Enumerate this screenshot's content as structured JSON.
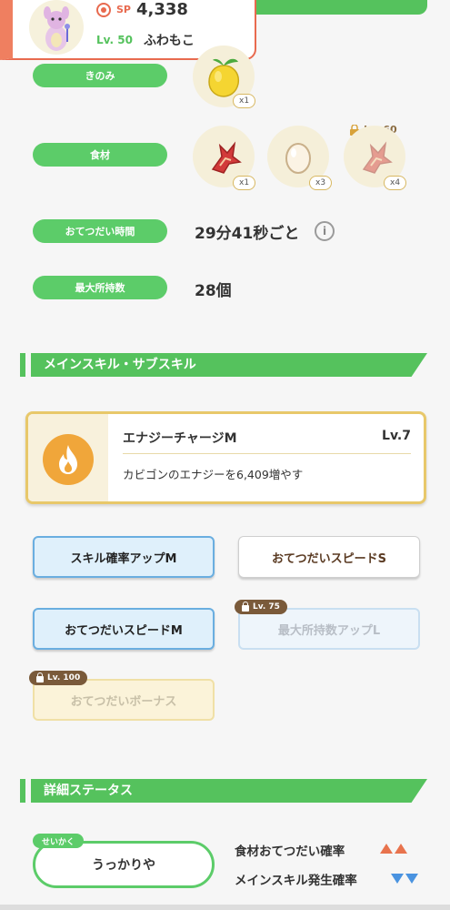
{
  "header": {
    "sp_label": "SP",
    "sp_value": "4,338",
    "level_label": "Lv. 50",
    "nickname": "ふわもこ"
  },
  "info": {
    "berry_label": "きのみ",
    "berry_qty": "x1",
    "ingredients_label": "食材",
    "ingredients": [
      {
        "icon": "tomato-icon",
        "qty": "x1"
      },
      {
        "icon": "egg-icon",
        "qty": "x3"
      },
      {
        "icon": "tomato-icon",
        "qty": "x4",
        "locked_level": "Lv. 60"
      }
    ],
    "help_time_label": "おてつだい時間",
    "help_time_value": "29分41秒ごと",
    "carry_label": "最大所持数",
    "carry_value": "28個"
  },
  "skills": {
    "section_title": "メインスキル・サブスキル",
    "main_skill": {
      "name": "エナジーチャージM",
      "level": "Lv.7",
      "description": "カビゴンのエナジーを6,409増やす"
    },
    "sub_skills": [
      {
        "label": "スキル確率アップM",
        "style": "blue"
      },
      {
        "label": "おてつだいスピードS",
        "style": "white"
      },
      {
        "label": "おてつだいスピードM",
        "style": "blue"
      },
      {
        "label": "最大所持数アップL",
        "style": "blue-locked",
        "lock_level": "Lv. 75"
      },
      {
        "label": "おてつだいボーナス",
        "style": "gold-locked",
        "lock_level": "Lv. 100"
      }
    ]
  },
  "details": {
    "section_title": "詳細ステータス",
    "nature_tag": "せいかく",
    "nature": "うっかりや",
    "up_stat": "食材おてつだい確率",
    "down_stat": "メインスキル発生確率"
  },
  "colors": {
    "accent_green": "#55c25d",
    "header_orange": "#e86a4f",
    "up_arrow": "#e8734d",
    "down_arrow": "#4a93e0"
  }
}
